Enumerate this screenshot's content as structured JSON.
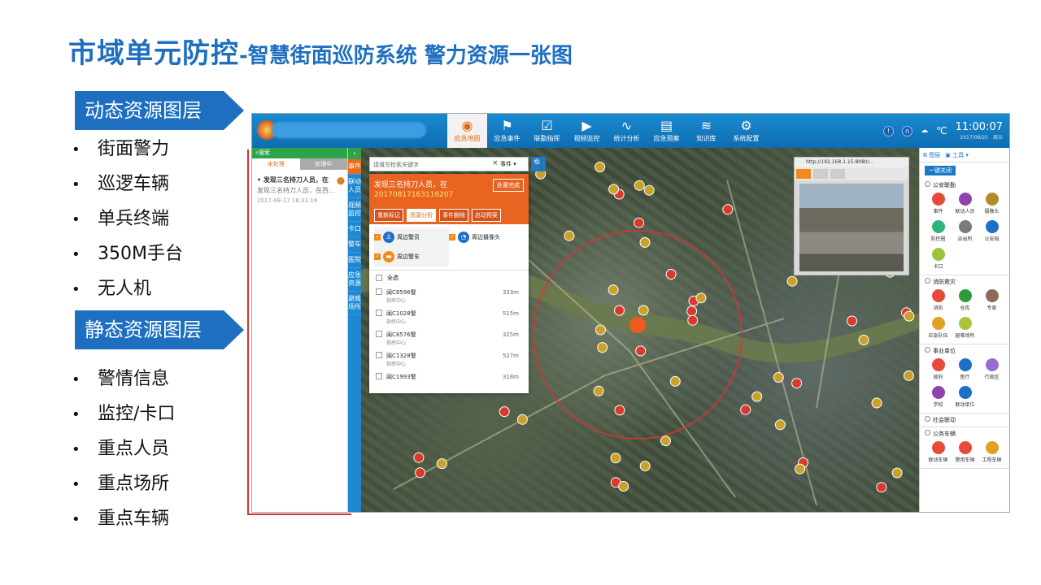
{
  "slide": {
    "title_main": "市域单元防控",
    "title_sub": "-智慧街面巡防系统 警力资源一张图",
    "sections": [
      {
        "label": "动态资源图层",
        "items": [
          "街面警力",
          "巡逻车辆",
          "单兵终端",
          "350M手台",
          "无人机"
        ]
      },
      {
        "label": "静态资源图层",
        "items": [
          "警情信息",
          "监控/卡口",
          "重点人员",
          "重点场所",
          "重点车辆"
        ]
      }
    ]
  },
  "app": {
    "nav": [
      {
        "label": "应急地图",
        "icon": "map-pin-icon",
        "glyph": "◉",
        "active": true
      },
      {
        "label": "应急事件",
        "icon": "chart-icon",
        "glyph": "⚑",
        "active": false
      },
      {
        "label": "联勤指挥",
        "icon": "clipboard-icon",
        "glyph": "☑",
        "active": false
      },
      {
        "label": "视频监控",
        "icon": "camera-icon",
        "glyph": "▶",
        "active": false
      },
      {
        "label": "统计分析",
        "icon": "trend-icon",
        "glyph": "∿",
        "active": false
      },
      {
        "label": "应急预案",
        "icon": "briefcase-icon",
        "glyph": "▤",
        "active": false
      },
      {
        "label": "知识库",
        "icon": "layers-icon",
        "glyph": "≋",
        "active": false
      },
      {
        "label": "系统配置",
        "icon": "gear-icon",
        "glyph": "⚙",
        "active": false
      }
    ],
    "topbar": {
      "temp": "℃",
      "time": "11:00:07",
      "date": "2017/08/25　周五"
    },
    "leftpanel": {
      "search_label": "搜索",
      "tabs": [
        "未处理",
        "处理中"
      ],
      "items": [
        {
          "title": "发现三名持刀人员，在",
          "desc": "发现三名持刀人员，在西...",
          "time": "2017-08-17 16:31:16"
        }
      ]
    },
    "vtabs": [
      "事件",
      "联动人员",
      "视频监控",
      "卡口",
      "警车",
      "医院",
      "应急资源",
      "避难场所"
    ],
    "search": {
      "placeholder": "请填写检索关键字",
      "select": "事件",
      "button": "🔍"
    },
    "popup": {
      "title": "发现三名持刀人员，在",
      "code": "20170817163116207",
      "done": "处置完成",
      "buttons": [
        "重新标记",
        "资源分析",
        "事件删除",
        "启动预案"
      ],
      "categories": [
        {
          "label": "周边警员",
          "checked": true,
          "selected": true
        },
        {
          "label": "周边摄像头",
          "checked": true,
          "selected": false
        },
        {
          "label": "周边警车",
          "checked": true,
          "selected": true
        }
      ],
      "all_label": "全选",
      "rows": [
        {
          "name": "闽C8596警",
          "sub": "指挥中心",
          "dist": "333m"
        },
        {
          "name": "闽C1028警",
          "sub": "指挥中心",
          "dist": "515m"
        },
        {
          "name": "闽C8576警",
          "sub": "指挥中心",
          "dist": "325m"
        },
        {
          "name": "闽C1328警",
          "sub": "指挥中心",
          "dist": "527m"
        },
        {
          "name": "闽C1993警",
          "sub": "",
          "dist": "318m"
        }
      ]
    },
    "video": {
      "url": "http://192.168.1.15:8080/..."
    },
    "rightpanel": {
      "tabs": [
        "图层",
        "工具"
      ],
      "one_key": "一键关闭",
      "sections": [
        {
          "label": "公安联勤",
          "items": [
            {
              "label": "事件",
              "color": "#e64a3a"
            },
            {
              "label": "联动人员",
              "color": "#8e44ad"
            },
            {
              "label": "摄像头",
              "color": "#b58a2a"
            },
            {
              "label": "防控圈",
              "color": "#2fb37a"
            },
            {
              "label": "派出所",
              "color": "#7a7a7a"
            },
            {
              "label": "公安局",
              "color": "#1e6fc8"
            },
            {
              "label": "卡口",
              "color": "#9bc43a"
            }
          ]
        },
        {
          "label": "消防救灾",
          "items": [
            {
              "label": "消防",
              "color": "#e64a3a"
            },
            {
              "label": "仓库",
              "color": "#2e9a3a"
            },
            {
              "label": "专家",
              "color": "#8a6a5a"
            },
            {
              "label": "应急队伍",
              "color": "#e0a020"
            },
            {
              "label": "避难场所",
              "color": "#a9c43a"
            }
          ]
        },
        {
          "label": "事业单位",
          "items": [
            {
              "label": "政府",
              "color": "#e64a3a"
            },
            {
              "label": "医疗",
              "color": "#1e6fc8"
            },
            {
              "label": "行政区",
              "color": "#9a6ad0"
            },
            {
              "label": "学校",
              "color": "#8e44ad"
            },
            {
              "label": "联动单位",
              "color": "#1e6fc8"
            }
          ]
        },
        {
          "label": "社会联动",
          "items": []
        },
        {
          "label": "公务车辆",
          "items": [
            {
              "label": "联动车辆",
              "color": "#e64a3a"
            },
            {
              "label": "警用车辆",
              "color": "#e64a3a"
            },
            {
              "label": "工程车辆",
              "color": "#e0a020"
            }
          ]
        }
      ]
    }
  }
}
